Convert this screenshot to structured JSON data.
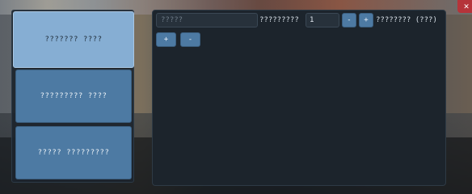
{
  "menu": {
    "items": [
      {
        "label": "??????? ????",
        "active": true
      },
      {
        "label": "????????? ????",
        "active": false
      },
      {
        "label": "????? ?????????",
        "active": false
      }
    ]
  },
  "form": {
    "name_placeholder": "?????",
    "quantity_label": "?????????",
    "quantity_value": "1",
    "decrement_label": "-",
    "increment_label": "+",
    "unit_label": "???????? (???)",
    "add_label": "+",
    "remove_label": "-"
  },
  "window": {
    "close_icon": "close-icon",
    "close_glyph": "✕"
  },
  "colors": {
    "accent": "#4d7aa3",
    "accent_active": "#86aed3",
    "panel_bg": "#1c242c",
    "close_red": "#b5343a"
  }
}
